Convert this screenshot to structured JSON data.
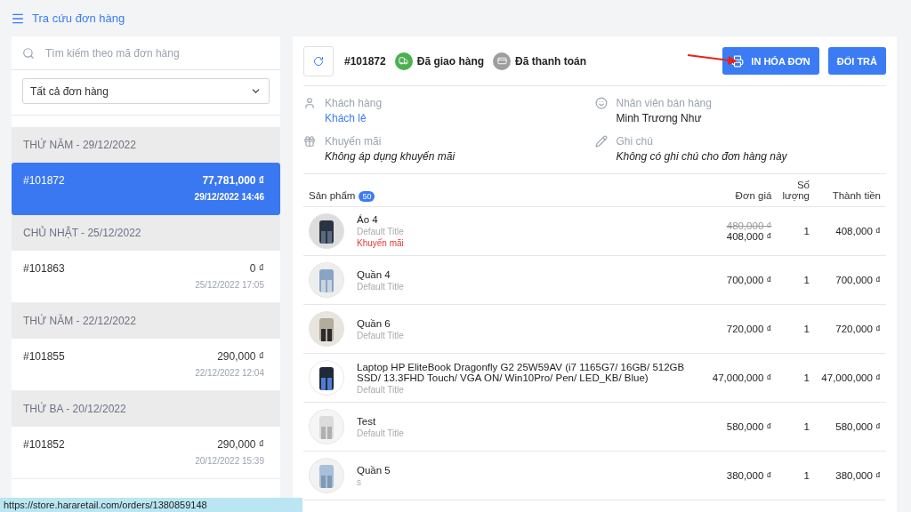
{
  "header": {
    "title": "Tra cứu đơn hàng"
  },
  "search": {
    "placeholder": "Tìm kiếm theo mã đơn hàng"
  },
  "filter": {
    "value": "Tất cả đơn hàng"
  },
  "order_groups": [
    {
      "date": "THỨ NĂM - 29/12/2022",
      "orders": [
        {
          "code": "#101872",
          "total": "77,781,000 ₫",
          "time": "29/12/2022 14:46",
          "selected": true
        }
      ]
    },
    {
      "date": "CHỦ NHẬT - 25/12/2022",
      "orders": [
        {
          "code": "#101863",
          "total": "0 ₫",
          "time": "25/12/2022 17:05",
          "selected": false
        }
      ]
    },
    {
      "date": "THỨ NĂM - 22/12/2022",
      "orders": [
        {
          "code": "#101855",
          "total": "290,000 ₫",
          "time": "22/12/2022 12:04",
          "selected": false
        }
      ]
    },
    {
      "date": "THỨ BA - 20/12/2022",
      "orders": [
        {
          "code": "#101852",
          "total": "290,000 ₫",
          "time": "20/12/2022 15:39",
          "selected": false
        }
      ]
    }
  ],
  "order": {
    "code": "#101872",
    "statuses": [
      {
        "kind": "delivery",
        "label": "Đã giao hàng",
        "color": "#4caf50"
      },
      {
        "kind": "payment",
        "label": "Đã thanh toán",
        "color": "#9e9e9e"
      }
    ],
    "buttons": [
      {
        "kind": "print",
        "label": "IN HÓA ĐƠN"
      },
      {
        "kind": "plain",
        "label": "ĐỔI TRẢ"
      }
    ],
    "info": [
      {
        "kind": "person",
        "label": "Khách hàng",
        "value": "Khách lẻ",
        "link": true,
        "italic": false
      },
      {
        "kind": "face",
        "label": "Nhân viên bán hàng",
        "value": "Minh Trương Như",
        "link": false,
        "italic": false
      },
      {
        "kind": "gift",
        "label": "Khuyến mãi",
        "value": "Không áp dụng khuyến mãi",
        "link": false,
        "italic": true
      },
      {
        "kind": "pencil",
        "label": "Ghi chú",
        "value": "Không có ghi chú cho đơn hàng này",
        "link": false,
        "italic": true
      }
    ]
  },
  "table": {
    "columns": [
      "Sản phẩm",
      "Đơn giá",
      "Số lượng",
      "Thành tiền"
    ],
    "count": "50",
    "rows": [
      {
        "name": "Áo 4",
        "variant": "Default Title",
        "promo": "Khuyến mãi",
        "old_price": "480,000 ₫",
        "price": "408,000 ₫",
        "qty": "1",
        "total": "408,000 ₫"
      },
      {
        "name": "Quần 4",
        "variant": "Default Title",
        "price": "700,000 ₫",
        "qty": "1",
        "total": "700,000 ₫"
      },
      {
        "name": "Quần 6",
        "variant": "Default Title",
        "price": "720,000 ₫",
        "qty": "1",
        "total": "720,000 ₫"
      },
      {
        "name": "Laptop HP EliteBook Dragonfly G2 25W59AV (i7 1165G7/ 16GB/ 512GB SSD/ 13.3FHD Touch/ VGA ON/ Win10Pro/ Pen/ LED_KB/ Blue)",
        "variant": "Default Title",
        "price": "47,000,000 ₫",
        "qty": "1",
        "total": "47,000,000 ₫"
      },
      {
        "name": "Test",
        "variant": "Default Title",
        "price": "580,000 ₫",
        "qty": "1",
        "total": "580,000 ₫"
      },
      {
        "name": "Quần 5",
        "variant": "s",
        "price": "380,000 ₫",
        "qty": "1",
        "total": "380,000 ₫"
      }
    ]
  },
  "status_bar": {
    "url": "https://store.hararetail.com/orders/1380859148"
  }
}
